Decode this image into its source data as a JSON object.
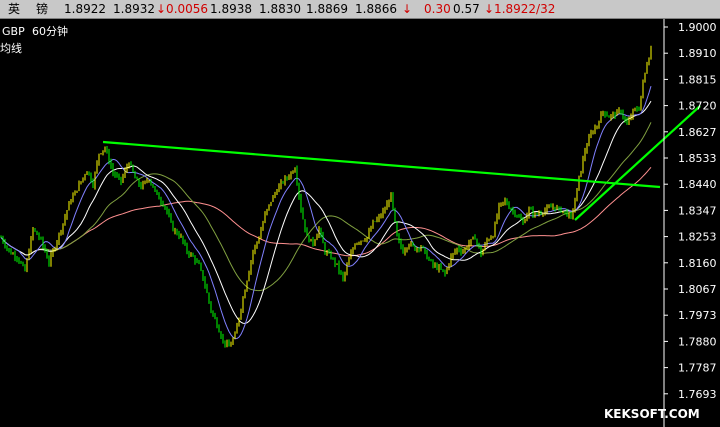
{
  "quote_bar": {
    "name_1": "英",
    "name_2": "镑",
    "open": "1.8922",
    "high": "1.8932",
    "change": "↓0.0056",
    "low": "1.8938",
    "close_1": "1.8830",
    "f1": "1.8869",
    "f2": "1.8866",
    "arrow": "↓",
    "f3": "0.30",
    "f4": "0.57",
    "last": "↓1.8922/32"
  },
  "chart_title": {
    "symbol": "GBP",
    "period": "60分钟",
    "indicator": "均线"
  },
  "watermark": "KEKSOFT.COM",
  "colors": {
    "background": "#000000",
    "candle": "#ffff00",
    "candle_down": "#00ff00",
    "ma1": "#ffffff",
    "ma2": "#8080ff",
    "ma3": "#80a040",
    "ma4": "#ff9090",
    "trendline": "#00ff00",
    "axis": "#ffffff"
  },
  "chart_data": {
    "type": "candlestick",
    "y_ticks": [
      "1.9000",
      "1.8910",
      "1.8815",
      "1.8720",
      "1.8627",
      "1.8533",
      "1.8440",
      "1.8347",
      "1.8253",
      "1.8160",
      "1.8067",
      "1.7973",
      "1.7880",
      "1.7787",
      "1.7693"
    ],
    "ylim": [
      1.765,
      1.903
    ],
    "close_path": [
      [
        0,
        1.825
      ],
      [
        4,
        1.82
      ],
      [
        8,
        1.818
      ],
      [
        12,
        1.813
      ],
      [
        16,
        1.828
      ],
      [
        20,
        1.824
      ],
      [
        24,
        1.816
      ],
      [
        28,
        1.824
      ],
      [
        31,
        1.83
      ],
      [
        34,
        1.837
      ],
      [
        37,
        1.841
      ],
      [
        40,
        1.845
      ],
      [
        43,
        1.849
      ],
      [
        46,
        1.844
      ],
      [
        49,
        1.855
      ],
      [
        52,
        1.857
      ],
      [
        56,
        1.848
      ],
      [
        60,
        1.845
      ],
      [
        64,
        1.852
      ],
      [
        67,
        1.846
      ],
      [
        70,
        1.843
      ],
      [
        74,
        1.846
      ],
      [
        78,
        1.84
      ],
      [
        82,
        1.836
      ],
      [
        86,
        1.828
      ],
      [
        90,
        1.825
      ],
      [
        93,
        1.82
      ],
      [
        96,
        1.818
      ],
      [
        99,
        1.815
      ],
      [
        102,
        1.808
      ],
      [
        105,
        1.799
      ],
      [
        108,
        1.794
      ],
      [
        111,
        1.788
      ],
      [
        114,
        1.786
      ],
      [
        117,
        1.79
      ],
      [
        120,
        1.8
      ],
      [
        123,
        1.81
      ],
      [
        126,
        1.82
      ],
      [
        129,
        1.825
      ],
      [
        132,
        1.833
      ],
      [
        135,
        1.838
      ],
      [
        138,
        1.842
      ],
      [
        141,
        1.845
      ],
      [
        144,
        1.847
      ],
      [
        147,
        1.85
      ],
      [
        150,
        1.835
      ],
      [
        153,
        1.825
      ],
      [
        156,
        1.823
      ],
      [
        159,
        1.828
      ],
      [
        162,
        1.82
      ],
      [
        165,
        1.818
      ],
      [
        168,
        1.815
      ],
      [
        171,
        1.81
      ],
      [
        174,
        1.817
      ],
      [
        177,
        1.823
      ],
      [
        180,
        1.824
      ],
      [
        183,
        1.825
      ],
      [
        186,
        1.83
      ],
      [
        189,
        1.832
      ],
      [
        192,
        1.835
      ],
      [
        195,
        1.84
      ],
      [
        198,
        1.825
      ],
      [
        201,
        1.82
      ],
      [
        204,
        1.823
      ],
      [
        207,
        1.821
      ],
      [
        210,
        1.822
      ],
      [
        213,
        1.818
      ],
      [
        216,
        1.815
      ],
      [
        219,
        1.814
      ],
      [
        222,
        1.812
      ],
      [
        225,
        1.818
      ],
      [
        228,
        1.821
      ],
      [
        231,
        1.82
      ],
      [
        234,
        1.823
      ],
      [
        237,
        1.825
      ],
      [
        240,
        1.819
      ],
      [
        243,
        1.824
      ],
      [
        246,
        1.826
      ],
      [
        249,
        1.836
      ],
      [
        252,
        1.838
      ],
      [
        255,
        1.835
      ],
      [
        258,
        1.833
      ],
      [
        261,
        1.83
      ],
      [
        264,
        1.835
      ],
      [
        267,
        1.833
      ],
      [
        270,
        1.834
      ],
      [
        273,
        1.835
      ],
      [
        276,
        1.836
      ],
      [
        279,
        1.835
      ],
      [
        282,
        1.834
      ],
      [
        285,
        1.832
      ],
      [
        287,
        1.838
      ],
      [
        289,
        1.846
      ],
      [
        292,
        1.856
      ],
      [
        295,
        1.862
      ],
      [
        298,
        1.865
      ],
      [
        301,
        1.87
      ],
      [
        304,
        1.868
      ],
      [
        307,
        1.869
      ],
      [
        310,
        1.87
      ],
      [
        313,
        1.865
      ],
      [
        316,
        1.87
      ],
      [
        319,
        1.871
      ],
      [
        321,
        1.88
      ],
      [
        323,
        1.887
      ],
      [
        325,
        1.892
      ]
    ]
  }
}
